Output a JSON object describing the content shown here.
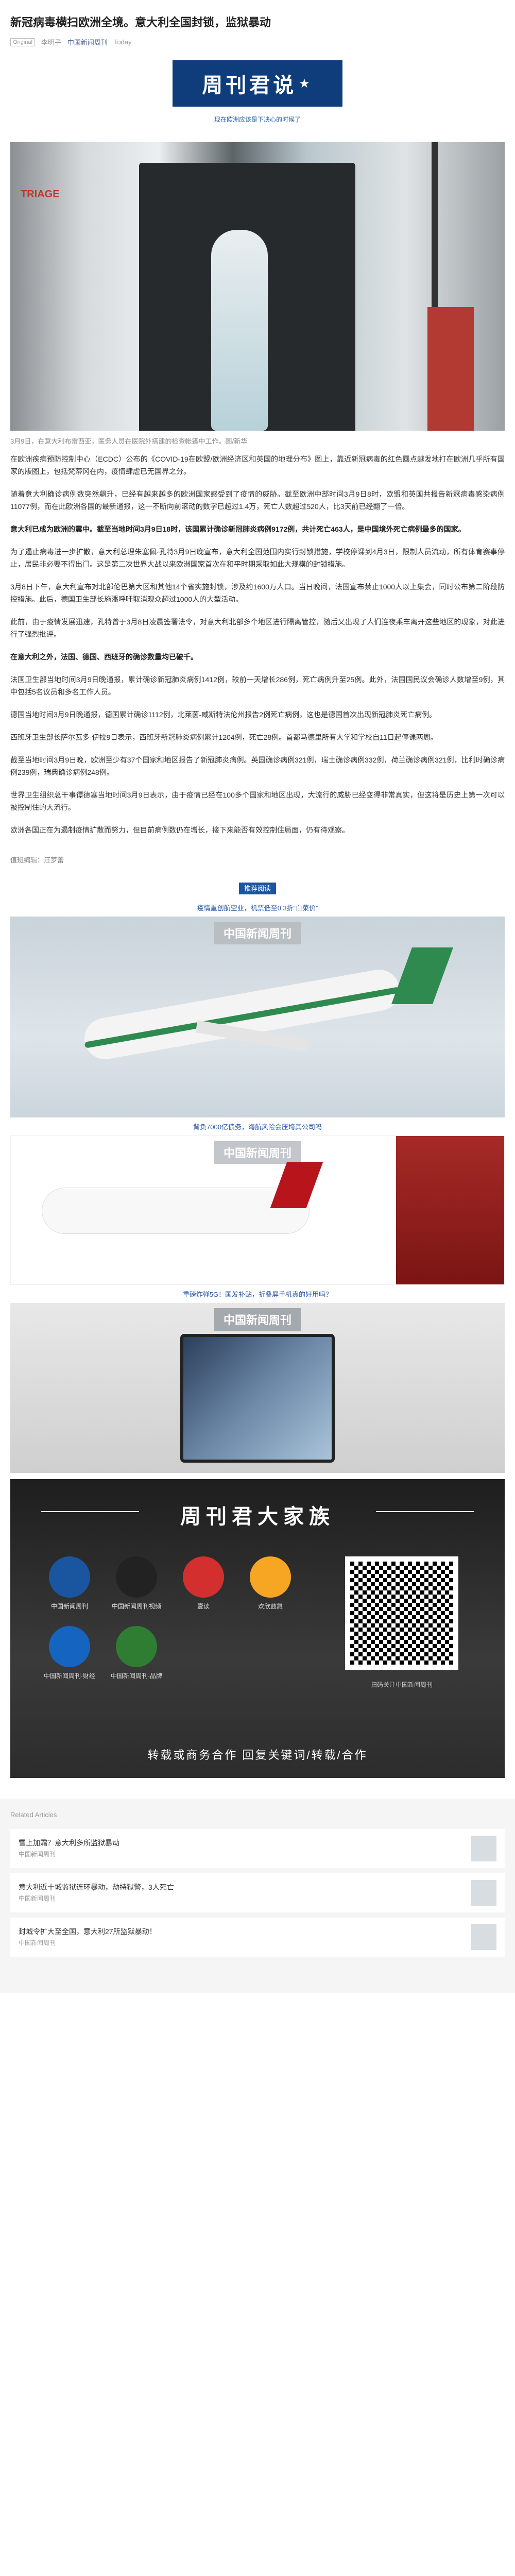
{
  "article": {
    "title": "新冠病毒横扫欧洲全境。意大利全国封锁，监狱暴动",
    "tag": "Original",
    "author": "李明子",
    "account": "中国新闻周刊",
    "date": "Today"
  },
  "banner": {
    "title": "周刊君说",
    "subtitle": "现在欧洲应该是下决心的时候了"
  },
  "hero": {
    "tent_label": "TRIAGE",
    "caption": "3月9日，在意大利布雷西亚，医务人员在医院外搭建的检查帐篷中工作。图/新华"
  },
  "paragraphs": [
    "在欧洲疾病预防控制中心（ECDC）公布的《COVID-19在欧盟/欧洲经济区和英国的地理分布》图上，靠近新冠病毒的红色圆点越发地打在欧洲几乎所有国家的版图上，包括梵蒂冈在内，疫情肆虐已无国界之分。",
    "随着意大利确诊病例数突然飙升，已经有越来越多的欧洲国家感受到了疫情的威胁。截至欧洲中部时间3月9日8时，欧盟和英国共报告新冠病毒感染病例11077例，而在此欧洲各国的最新通报，这一不断向前滚动的数字已超过1.4万，死亡人数超过520人，比3天前已经翻了一倍。",
    "意大利已成为欧洲的震中。截至当地时间3月9日18时，该国累计确诊新冠肺炎病例9172例，共计死亡463人，是中国境外死亡病例最多的国家。",
    "为了遏止病毒进一步扩散，意大利总理朱塞佩·孔特3月9日晚宣布，意大利全国范围内实行封锁措施，学校停课到4月3日，限制人员流动，所有体育赛事停止，居民非必要不得出门。这是第二次世界大战以来欧洲国家首次在和平时期采取如此大规模的封锁措施。",
    "3月8日下午，意大利宣布对北部伦巴第大区和其他14个省实施封锁，涉及约1600万人口。当日晚间，法国宣布禁止1000人以上集会，同时公布第二阶段防控措施。此后，德国卫生部长施潘呼吁取消观众超过1000人的大型活动。",
    "此前，由于疫情发展迅速，孔特曾于3月8日凌晨签署法令，对意大利北部多个地区进行隔离管控，随后又出现了人们连夜乘车离开这些地区的现象，对此进行了强烈批评。",
    "在意大利之外，法国、德国、西班牙的确诊数量均已破千。",
    "法国卫生部当地时间3月9日晚通报，累计确诊新冠肺炎病例1412例，较前一天增长286例，死亡病例升至25例。此外，法国国民议会确诊人数增至9例，其中包括5名议员和多名工作人员。",
    "德国当地时间3月9日晚通报，德国累计确诊1112例，北莱茵-威斯特法伦州报告2例死亡病例，这也是德国首次出现新冠肺炎死亡病例。",
    "西班牙卫生部长萨尔瓦多·伊拉9日表示，西班牙新冠肺炎病例累计1204例，死亡28例。首都马德里所有大学和学校自11日起停课两周。",
    "截至当地时间3月9日晚，欧洲至少有37个国家和地区报告了新冠肺炎病例。英国确诊病例321例，瑞士确诊病例332例，荷兰确诊病例321例，比利时确诊病例239例，瑞典确诊病例248例。",
    "世界卫生组织总干事谭德塞当地时间3月9日表示，由于疫情已经在100多个国家和地区出现，大流行的威胁已经变得非常真实，但这将是历史上第一次可以被控制住的大流行。",
    "欧洲各国正在为遏制疫情扩散而努力，但目前病例数仍在增长，接下来能否有效控制住局面，仍有待观察。"
  ],
  "bold_paragraph_indices": [
    2,
    6
  ],
  "editor": "值班编辑：汪梦蕾",
  "recommend": {
    "label": "推荐阅读",
    "items": [
      {
        "headline": "疫情重创航空业，机票低至0.3折“白菜价”",
        "logo": "中国新闻周刊"
      },
      {
        "headline": "背负7000亿债务，海航风险会压垮其公司吗",
        "logo": "中国新闻周刊"
      },
      {
        "headline": "重磅炸弹5G！国发补贴，折叠屏手机真的好用吗？",
        "logo": "中国新闻周刊"
      }
    ]
  },
  "family": {
    "title": "周刊君大家族",
    "members": [
      {
        "name": "中国新闻周刊",
        "color": "#1a56a0"
      },
      {
        "name": "中国新闻周刊视频",
        "color": "#222222"
      },
      {
        "name": "壹读",
        "color": "#d32f2f"
      },
      {
        "name": "欢欣鼓舞",
        "color": "#f6a623"
      },
      {
        "name": "中国新闻周刊·财经",
        "color": "#1565c0"
      },
      {
        "name": "中国新闻周刊·品牌",
        "color": "#2e7d32"
      }
    ],
    "qr_label": "扫码关注中国新闻周刊",
    "footer": "转载或商务合作  回复关键词/转载/合作"
  },
  "related": {
    "title": "Related Articles",
    "items": [
      {
        "text": "雪上加霜？意大利多所监狱暴动",
        "account": "中国新闻周刊"
      },
      {
        "text": "意大利近十城监狱连环暴动，劫持狱警，3人死亡",
        "account": "中国新闻周刊"
      },
      {
        "text": "封城令扩大至全国，意大利27所监狱暴动！",
        "account": "中国新闻周刊"
      }
    ]
  }
}
